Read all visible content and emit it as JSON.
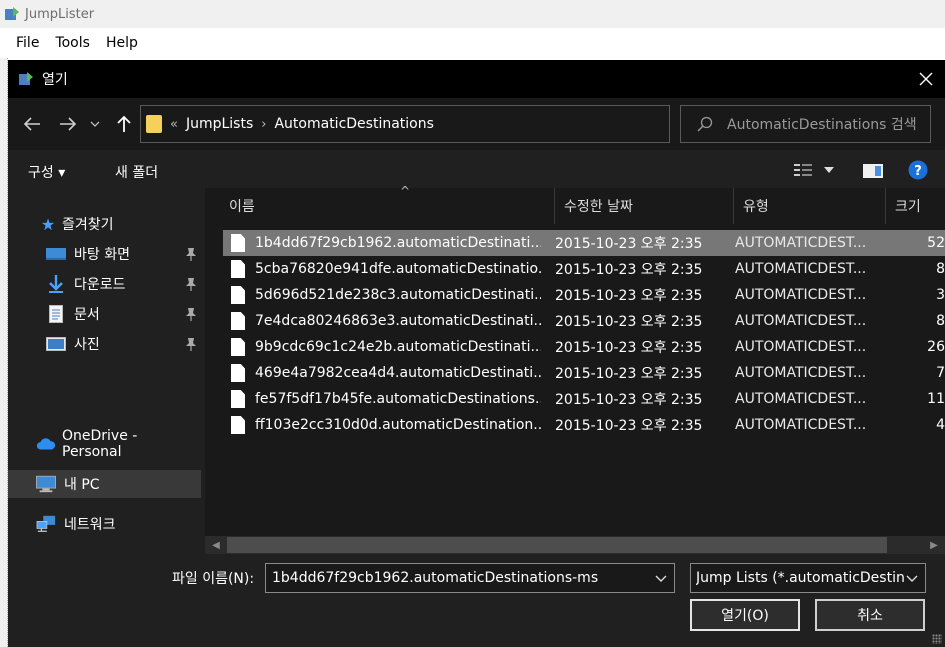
{
  "app": {
    "title": "JumpLister",
    "menu": [
      "File",
      "Tools",
      "Help"
    ]
  },
  "dialog": {
    "title": "열기",
    "address": {
      "overflow": "«",
      "crumbs": [
        "JumpLists",
        "AutomaticDestinations"
      ]
    },
    "search_placeholder": "AutomaticDestinations 검색",
    "commands": {
      "organize": "구성 ▾",
      "new_folder": "새 폴더"
    },
    "nav": [
      {
        "label": "즐겨찾기",
        "icon": "star-icon"
      },
      {
        "label": "바탕 화면",
        "icon": "desktop-icon",
        "pinned": true
      },
      {
        "label": "다운로드",
        "icon": "download-icon",
        "pinned": true
      },
      {
        "label": "문서",
        "icon": "document-icon",
        "pinned": true
      },
      {
        "label": "사진",
        "icon": "pictures-icon",
        "pinned": true
      },
      {
        "label": "OneDrive - Personal",
        "icon": "cloud-icon"
      },
      {
        "label": "내 PC",
        "icon": "computer-icon",
        "selected": true
      },
      {
        "label": "네트워크",
        "icon": "network-icon"
      }
    ],
    "columns": {
      "name": "이름",
      "date": "수정한 날짜",
      "type": "유형",
      "size": "크기"
    },
    "files": [
      {
        "name": "1b4dd67f29cb1962.automaticDestinati...",
        "date": "2015-10-23 오후 2:35",
        "type": "AUTOMATICDEST...",
        "size": "52",
        "selected": true
      },
      {
        "name": "5cba76820e941dfe.automaticDestinatio...",
        "date": "2015-10-23 오후 2:35",
        "type": "AUTOMATICDEST...",
        "size": "8"
      },
      {
        "name": "5d696d521de238c3.automaticDestinati...",
        "date": "2015-10-23 오후 2:35",
        "type": "AUTOMATICDEST...",
        "size": "3"
      },
      {
        "name": "7e4dca80246863e3.automaticDestinati...",
        "date": "2015-10-23 오후 2:35",
        "type": "AUTOMATICDEST...",
        "size": "8"
      },
      {
        "name": "9b9cdc69c1c24e2b.automaticDestinati...",
        "date": "2015-10-23 오후 2:35",
        "type": "AUTOMATICDEST...",
        "size": "26"
      },
      {
        "name": "469e4a7982cea4d4.automaticDestinati...",
        "date": "2015-10-23 오후 2:35",
        "type": "AUTOMATICDEST...",
        "size": "7"
      },
      {
        "name": "fe57f5df17b45fe.automaticDestinations...",
        "date": "2015-10-23 오후 2:35",
        "type": "AUTOMATICDEST...",
        "size": "11"
      },
      {
        "name": "ff103e2cc310d0d.automaticDestination...",
        "date": "2015-10-23 오후 2:35",
        "type": "AUTOMATICDEST...",
        "size": "4"
      }
    ],
    "filename_label": "파일 이름(N):",
    "filename_value": "1b4dd67f29cb1962.automaticDestinations-ms",
    "filter_value": "Jump Lists (*.automaticDestinations",
    "open_button": "열기(O)",
    "cancel_button": "취소"
  }
}
